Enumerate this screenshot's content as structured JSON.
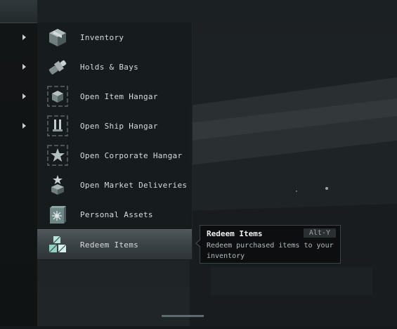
{
  "menu": {
    "items": [
      {
        "label": "Inventory",
        "icon": "inventory-icon",
        "has_submenu": true
      },
      {
        "label": "Holds & Bays",
        "icon": "holds-bays-icon",
        "has_submenu": true
      },
      {
        "label": "Open Item Hangar",
        "icon": "item-hangar-icon",
        "has_submenu": true
      },
      {
        "label": "Open Ship Hangar",
        "icon": "ship-hangar-icon",
        "has_submenu": true
      },
      {
        "label": "Open Corporate Hangar",
        "icon": "corporate-hangar-icon",
        "has_submenu": false
      },
      {
        "label": "Open Market Deliveries",
        "icon": "market-deliveries-icon",
        "has_submenu": false
      },
      {
        "label": "Personal Assets",
        "icon": "personal-assets-icon",
        "has_submenu": false
      },
      {
        "label": "Redeem Items",
        "icon": "redeem-items-icon",
        "has_submenu": false,
        "selected": true
      }
    ]
  },
  "tooltip": {
    "title": "Redeem Items",
    "shortcut": "Alt-Y",
    "description": "Redeem purchased items to your inventory"
  },
  "colors": {
    "menu_bg": "#161b1d",
    "text": "#d7dbdc",
    "icon_teal": "#8fb3b0",
    "highlight": "#4f575a"
  }
}
